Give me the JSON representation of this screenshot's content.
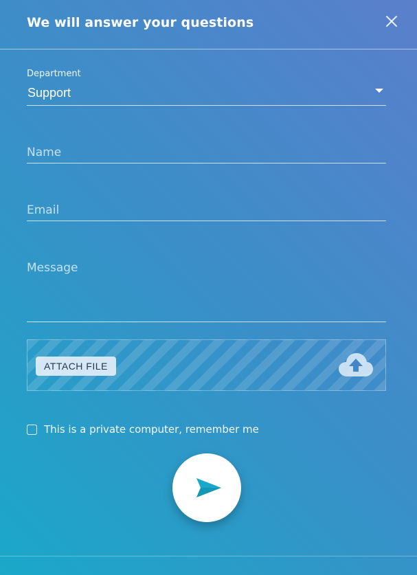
{
  "header": {
    "title": "We will answer your questions",
    "close_icon": "close-icon"
  },
  "form": {
    "department": {
      "label": "Department",
      "value": "Support"
    },
    "name": {
      "placeholder": "Name"
    },
    "email": {
      "placeholder": "Email"
    },
    "message": {
      "placeholder": "Message"
    },
    "attach": {
      "button_label": "ATTACH FILE",
      "icon": "cloud-upload-icon"
    },
    "remember": {
      "label": "This is a private computer, remember me",
      "checked": false
    },
    "send": {
      "icon": "send-icon"
    }
  },
  "colors": {
    "accent": "#1aa8c9",
    "gradient_top_right": "#5a7fcb",
    "gradient_bottom_left": "#1aa8c9",
    "attach_button_text": "#26374f"
  }
}
